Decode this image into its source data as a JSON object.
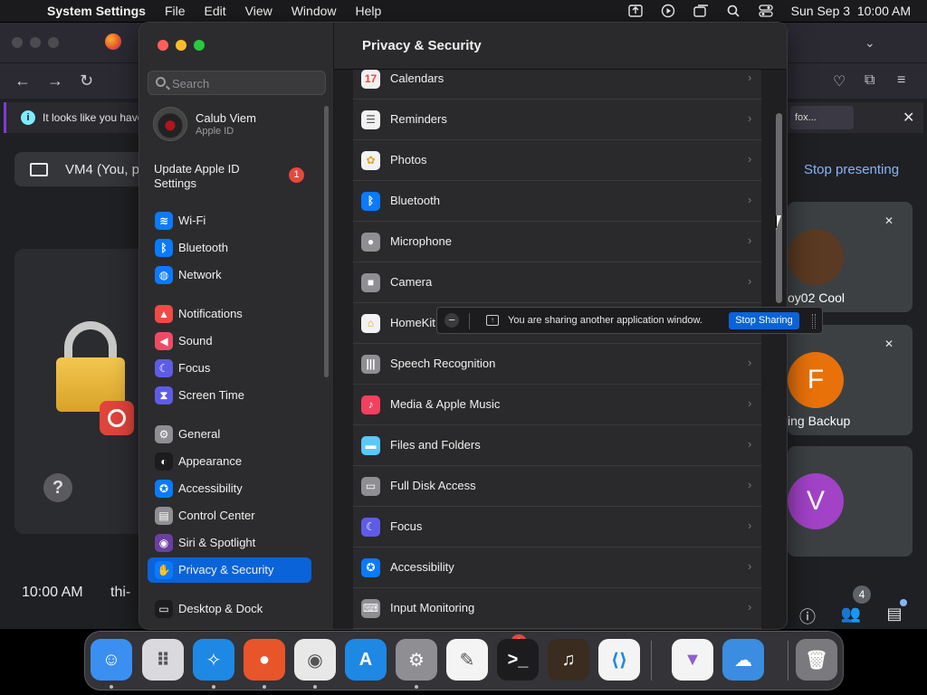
{
  "menubar": {
    "app_name": "System Settings",
    "menus": [
      "File",
      "Edit",
      "View",
      "Window",
      "Help"
    ],
    "clock": "Sun Sep 3  10:00 AM"
  },
  "browser": {
    "info_text": "It looks like you have",
    "info_button": "fox...",
    "present_text": "VM4 (You, p",
    "stop_presenting": "Stop presenting",
    "meeting_time": "10:00 AM",
    "meeting_code": "thi-",
    "participants": [
      {
        "name": "oy02 Cool",
        "initial": ""
      },
      {
        "name": "ing Backup",
        "initial": "F",
        "color": "#e8710a"
      },
      {
        "name": "",
        "initial": "V",
        "color": "#a142c7"
      }
    ],
    "people_count": "4"
  },
  "settings": {
    "search_placeholder": "Search",
    "account_name": "Calub Viem",
    "account_sub": "Apple ID",
    "update_label": "Update Apple ID Settings",
    "update_badge": "1",
    "sidebar": [
      {
        "label": "Wi-Fi",
        "icon": "wifi-icon",
        "color": "#0a7aff",
        "glyph": "≋"
      },
      {
        "label": "Bluetooth",
        "icon": "bluetooth-icon",
        "color": "#0a7aff",
        "glyph": "ᛒ"
      },
      {
        "label": "Network",
        "icon": "globe-icon",
        "color": "#0a7aff",
        "glyph": "◍"
      },
      {
        "label": "Notifications",
        "icon": "bell-icon",
        "color": "#ef4a45",
        "glyph": "▲"
      },
      {
        "label": "Sound",
        "icon": "speaker-icon",
        "color": "#ef4a65",
        "glyph": "◀"
      },
      {
        "label": "Focus",
        "icon": "moon-icon",
        "color": "#5e5ce6",
        "glyph": "☾"
      },
      {
        "label": "Screen Time",
        "icon": "hourglass-icon",
        "color": "#5e5ce6",
        "glyph": "⧗"
      },
      {
        "label": "General",
        "icon": "gear-icon",
        "color": "#8e8e93",
        "glyph": "⚙"
      },
      {
        "label": "Appearance",
        "icon": "appearance-icon",
        "color": "#1c1c1e",
        "glyph": "◐"
      },
      {
        "label": "Accessibility",
        "icon": "accessibility-icon",
        "color": "#0a7aff",
        "glyph": "✪"
      },
      {
        "label": "Control Center",
        "icon": "control-center-icon",
        "color": "#8e8e93",
        "glyph": "▤"
      },
      {
        "label": "Siri & Spotlight",
        "icon": "siri-icon",
        "color": "#6b3fa0",
        "glyph": "◉"
      },
      {
        "label": "Privacy & Security",
        "icon": "hand-icon",
        "color": "#0a7aff",
        "glyph": "✋"
      },
      {
        "label": "Desktop & Dock",
        "icon": "dock-icon",
        "color": "#1c1c1e",
        "glyph": "▭"
      }
    ],
    "content_title": "Privacy & Security",
    "rows": [
      {
        "label": "Calendars",
        "icon": "calendar-icon",
        "color": "#f2f2f2",
        "glyph": "17",
        "fg": "#e5483e"
      },
      {
        "label": "Reminders",
        "icon": "reminders-icon",
        "color": "#f2f2f2",
        "glyph": "☰",
        "fg": "#555"
      },
      {
        "label": "Photos",
        "icon": "photos-icon",
        "color": "#f2f2f2",
        "glyph": "✿",
        "fg": "#e8a31f"
      },
      {
        "label": "Bluetooth",
        "icon": "bluetooth-icon",
        "color": "#0a7aff",
        "glyph": "ᛒ",
        "fg": "#fff"
      },
      {
        "label": "Microphone",
        "icon": "microphone-icon",
        "color": "#8e8e93",
        "glyph": "●",
        "fg": "#fff"
      },
      {
        "label": "Camera",
        "icon": "camera-icon",
        "color": "#8e8e93",
        "glyph": "■",
        "fg": "#fff"
      },
      {
        "label": "HomeKit",
        "icon": "home-icon",
        "color": "#f2f2f2",
        "glyph": "⌂",
        "fg": "#f29b1f"
      },
      {
        "label": "Speech Recognition",
        "icon": "waveform-icon",
        "color": "#8e8e93",
        "glyph": "|||",
        "fg": "#fff"
      },
      {
        "label": "Media & Apple Music",
        "icon": "music-icon",
        "color": "#f2405f",
        "glyph": "♪",
        "fg": "#fff"
      },
      {
        "label": "Files and Folders",
        "icon": "folder-icon",
        "color": "#5ac8fa",
        "glyph": "▬",
        "fg": "#fff"
      },
      {
        "label": "Full Disk Access",
        "icon": "disk-icon",
        "color": "#8e8e93",
        "glyph": "▭",
        "fg": "#fff"
      },
      {
        "label": "Focus",
        "icon": "moon-icon",
        "color": "#5e5ce6",
        "glyph": "☾",
        "fg": "#fff"
      },
      {
        "label": "Accessibility",
        "icon": "accessibility-icon",
        "color": "#0a7aff",
        "glyph": "✪",
        "fg": "#fff"
      },
      {
        "label": "Input Monitoring",
        "icon": "keyboard-icon",
        "color": "#8e8e93",
        "glyph": "⌨",
        "fg": "#fff"
      }
    ]
  },
  "share_banner": {
    "message": "You are sharing another application window.",
    "stop_label": "Stop Sharing"
  },
  "dock": {
    "apps": [
      {
        "name": "Finder",
        "icon": "finder-icon",
        "color": "#3b8ff0",
        "glyph": "☺",
        "running": true
      },
      {
        "name": "Launchpad",
        "icon": "launchpad-icon",
        "color": "#d9d9de",
        "glyph": "⠿",
        "running": false
      },
      {
        "name": "Safari",
        "icon": "safari-icon",
        "color": "#1e88e5",
        "glyph": "✧",
        "running": true
      },
      {
        "name": "Firefox",
        "icon": "firefox-icon",
        "color": "#e8552a",
        "glyph": "●",
        "running": true
      },
      {
        "name": "Chrome",
        "icon": "chrome-icon",
        "color": "#e8e8e8",
        "glyph": "◉",
        "running": true
      },
      {
        "name": "App Store",
        "icon": "app-store-icon",
        "color": "#1e88e5",
        "glyph": "A",
        "running": false
      },
      {
        "name": "System Settings",
        "icon": "system-settings-icon",
        "color": "#8e8e93",
        "glyph": "⚙",
        "running": true,
        "badge": "1"
      },
      {
        "name": "TextEdit",
        "icon": "textedit-icon",
        "color": "#f4f4f4",
        "glyph": "✎",
        "running": false
      },
      {
        "name": "Terminal",
        "icon": "terminal-icon",
        "color": "#1c1c1e",
        "glyph": ">_",
        "running": false
      },
      {
        "name": "GarageBand",
        "icon": "guitar-icon",
        "color": "#3a2c1e",
        "glyph": "♫",
        "running": false
      },
      {
        "name": "VS Code",
        "icon": "vscode-icon",
        "color": "#f4f4f4",
        "glyph": "⟨⟩",
        "running": false
      },
      {
        "name": "Visual Studio",
        "icon": "visual-studio-icon",
        "color": "#f4f4f4",
        "glyph": "▼",
        "running": false
      },
      {
        "name": "Weather",
        "icon": "weather-icon",
        "color": "#3a8de0",
        "glyph": "☁",
        "running": false
      },
      {
        "name": "Trash",
        "icon": "trash-icon",
        "color": "#7a7a7e",
        "glyph": "🗑",
        "running": false
      }
    ]
  }
}
